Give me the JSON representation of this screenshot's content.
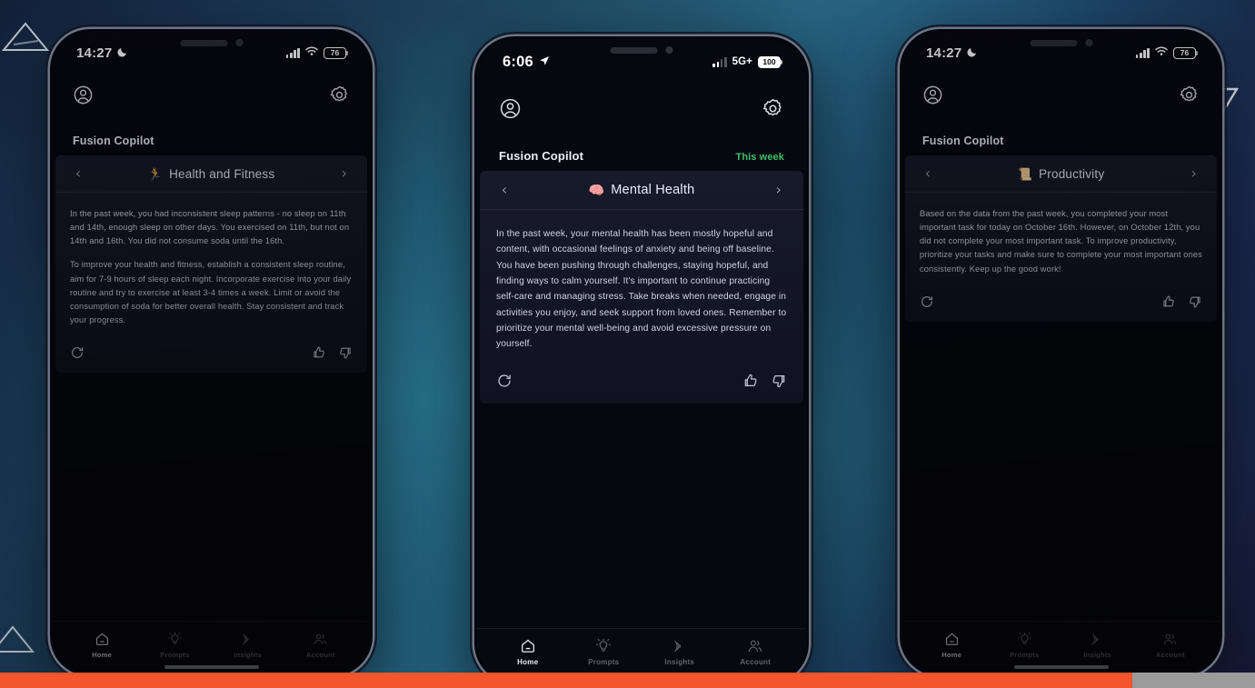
{
  "scene": {
    "overlay_triangles": [
      "triangle-outline-top-left",
      "triangle-outline-bottom-left",
      "triangle-outline-top-right"
    ],
    "accent_orange": "#f4552c",
    "accent_green": "#3fc06a",
    "background_teal": "#2a6a86",
    "background_navy": "#171b3a"
  },
  "phones": [
    {
      "id": "phone-health",
      "status": {
        "time": "14:27",
        "time_icon": "crescent-moon-icon",
        "network": "",
        "signal_strength": 4,
        "wifi": true,
        "battery": "76",
        "battery_full": false
      },
      "header": {
        "profile_icon": "account-circle-icon",
        "settings_icon": "gear-icon"
      },
      "brand": {
        "title": "Fusion Copilot",
        "week_label": ""
      },
      "category": {
        "emoji": "🏃",
        "name": "Health and Fitness",
        "prev_icon": "chevron-left-icon",
        "next_icon": "chevron-right-icon",
        "prev_label": "‹",
        "next_label": "›"
      },
      "paragraphs": [
        "In the past week, you had inconsistent sleep patterns - no sleep on 11th and 14th, enough sleep on other days. You exercised on 11th, but not on 14th and 16th. You did not consume soda until the 16th.",
        "To improve your health and fitness, establish a consistent sleep routine, aim for 7-9 hours of sleep each night. Incorporate exercise into your daily routine and try to exercise at least 3-4 times a week. Limit or avoid the consumption of soda for better overall health. Stay consistent and track your progress."
      ],
      "actions": {
        "refresh_icon": "refresh-icon",
        "thumbs_up_icon": "thumbs-up-icon",
        "thumbs_down_icon": "thumbs-down-icon"
      },
      "tabs": [
        {
          "label": "Home",
          "icon": "home-icon",
          "active": true
        },
        {
          "label": "Prompts",
          "icon": "lightbulb-icon",
          "active": false
        },
        {
          "label": "Insights",
          "icon": "radar-icon",
          "active": false
        },
        {
          "label": "Account",
          "icon": "people-icon",
          "active": false
        }
      ]
    },
    {
      "id": "phone-mental-health",
      "status": {
        "time": "6:06",
        "time_icon": "location-arrow-icon",
        "network": "5G+",
        "signal_strength": 2,
        "wifi": false,
        "battery": "100",
        "battery_full": true
      },
      "header": {
        "profile_icon": "account-circle-icon",
        "settings_icon": "gear-icon"
      },
      "brand": {
        "title": "Fusion Copilot",
        "week_label": "This week"
      },
      "category": {
        "emoji": "🧠",
        "name": "Mental Health",
        "prev_icon": "chevron-left-icon",
        "next_icon": "chevron-right-icon",
        "prev_label": "‹",
        "next_label": "›"
      },
      "paragraphs": [
        "In the past week, your mental health has been mostly hopeful and content, with occasional feelings of anxiety and being off baseline. You have been pushing through challenges, staying hopeful, and finding ways to calm yourself. It's important to continue practicing self-care and managing stress. Take breaks when needed, engage in activities you enjoy, and seek support from loved ones. Remember to prioritize your mental well-being and avoid excessive pressure on yourself."
      ],
      "actions": {
        "refresh_icon": "refresh-icon",
        "thumbs_up_icon": "thumbs-up-icon",
        "thumbs_down_icon": "thumbs-down-icon"
      },
      "tabs": [
        {
          "label": "Home",
          "icon": "home-icon",
          "active": true
        },
        {
          "label": "Prompts",
          "icon": "lightbulb-icon",
          "active": false
        },
        {
          "label": "Insights",
          "icon": "radar-icon",
          "active": false
        },
        {
          "label": "Account",
          "icon": "people-icon",
          "active": false
        }
      ]
    },
    {
      "id": "phone-productivity",
      "status": {
        "time": "14:27",
        "time_icon": "crescent-moon-icon",
        "network": "",
        "signal_strength": 4,
        "wifi": true,
        "battery": "76",
        "battery_full": false
      },
      "header": {
        "profile_icon": "account-circle-icon",
        "settings_icon": "gear-icon"
      },
      "brand": {
        "title": "Fusion Copilot",
        "week_label": ""
      },
      "category": {
        "emoji": "📜",
        "name": "Productivity",
        "prev_icon": "chevron-left-icon",
        "next_icon": "chevron-right-icon",
        "prev_label": "‹",
        "next_label": "›"
      },
      "paragraphs": [
        "Based on the data from the past week, you completed your most important task for today on October 16th. However, on October 12th, you did not complete your most important task. To improve productivity, prioritize your tasks and make sure to complete your most important ones consistently. Keep up the good work!"
      ],
      "actions": {
        "refresh_icon": "refresh-icon",
        "thumbs_up_icon": "thumbs-up-icon",
        "thumbs_down_icon": "thumbs-down-icon"
      },
      "tabs": [
        {
          "label": "Home",
          "icon": "home-icon",
          "active": true
        },
        {
          "label": "Prompts",
          "icon": "lightbulb-icon",
          "active": false
        },
        {
          "label": "Insights",
          "icon": "radar-icon",
          "active": false
        },
        {
          "label": "Account",
          "icon": "people-icon",
          "active": false
        }
      ]
    }
  ]
}
